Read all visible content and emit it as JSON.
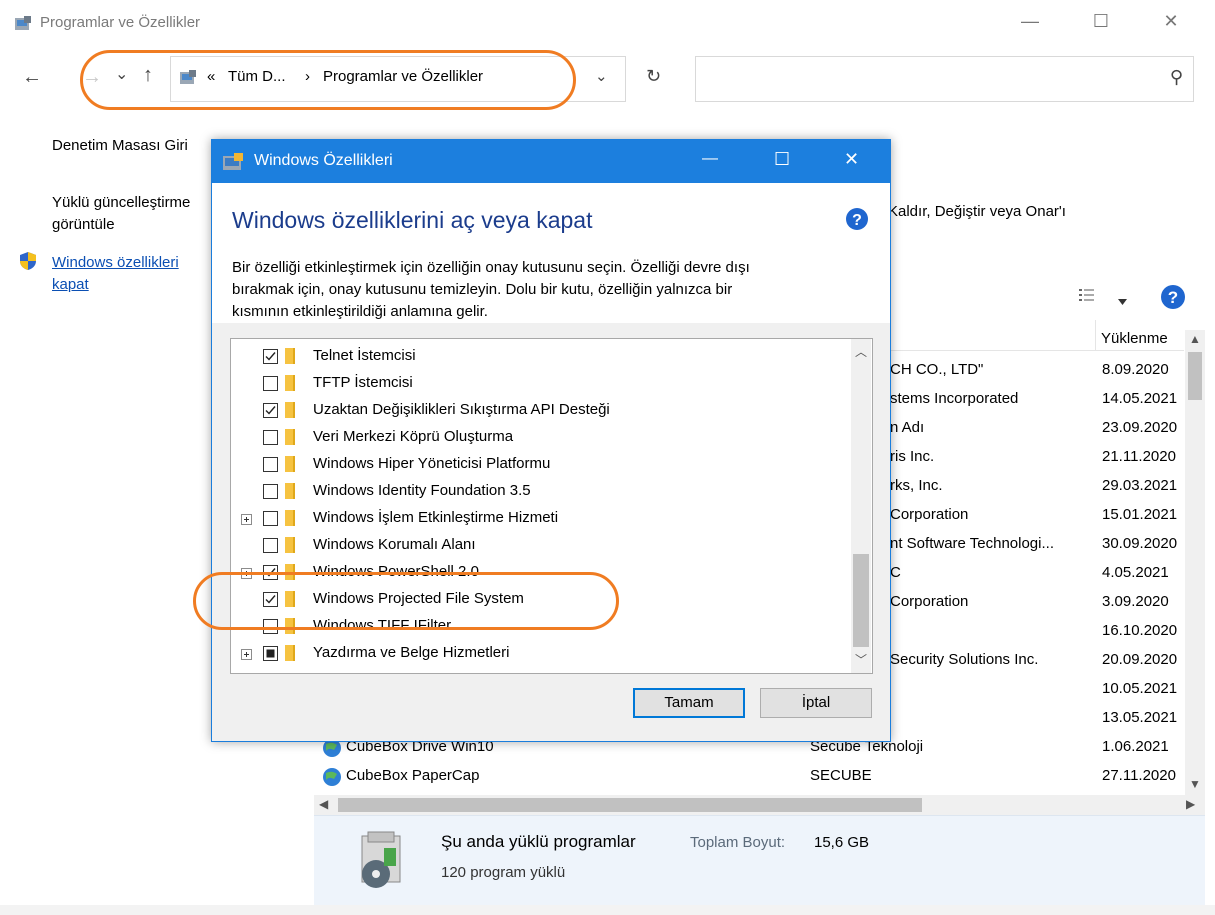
{
  "window": {
    "title": "Programlar ve Özellikler",
    "minimize_glyph": "—",
    "maximize_glyph": "☐",
    "close_glyph": "✕"
  },
  "nav": {
    "back_glyph": "←",
    "forward_glyph": "→",
    "recent_glyph": "⌄",
    "up_glyph": "↑",
    "breadcrumb_prefix": "«",
    "breadcrumb_root": "Tüm D...",
    "breadcrumb_sep": "›",
    "breadcrumb_current": "Programlar ve Özellikler",
    "dropdown_glyph": "⌄",
    "refresh_glyph": "↻",
    "search_glyph": "⚲"
  },
  "sidebar": {
    "home": "Denetim Masası Giri",
    "updates_line1": "Yüklü güncelleştirme",
    "updates_line2": "görüntüle",
    "features_line1": "Windows özellikleri",
    "features_line2": "kapat"
  },
  "main": {
    "intro_tail": "Kaldır, Değiştir veya Onar'ı",
    "col_installed": "Yüklenme",
    "rows": [
      {
        "name": "",
        "publisher": "CH CO., LTD\"",
        "date": "8.09.2020"
      },
      {
        "name": "",
        "publisher": "stems Incorporated",
        "date": "14.05.2021"
      },
      {
        "name": "",
        "publisher": "n Adı",
        "date": "23.09.2020"
      },
      {
        "name": "",
        "publisher": "ris Inc.",
        "date": "21.11.2020"
      },
      {
        "name": "",
        "publisher": "rks, Inc.",
        "date": "29.03.2021"
      },
      {
        "name": "",
        "publisher": "Corporation",
        "date": "15.01.2021"
      },
      {
        "name": "",
        "publisher": "nt Software Technologi...",
        "date": "30.09.2020"
      },
      {
        "name": "",
        "publisher": "C",
        "date": "4.05.2021"
      },
      {
        "name": "",
        "publisher": "Corporation",
        "date": "3.09.2020"
      },
      {
        "name": "",
        "publisher": "",
        "date": "16.10.2020"
      },
      {
        "name": "",
        "publisher": "Security Solutions Inc.",
        "date": "20.09.2020"
      },
      {
        "name": "",
        "publisher": "",
        "date": "10.05.2021"
      },
      {
        "name": "",
        "publisher": "",
        "date": "13.05.2021"
      },
      {
        "name": "CubeBox Drive Win10",
        "publisher": "Secube Teknoloji",
        "date": "1.06.2021"
      },
      {
        "name": "CubeBox PaperCap",
        "publisher": "SECUBE",
        "date": "27.11.2020"
      }
    ],
    "status_title": "Şu anda yüklü programlar",
    "status_size_label": "Toplam Boyut:",
    "status_size_value": "15,6 GB",
    "status_count": "120 program yüklü"
  },
  "dialog": {
    "title": "Windows Özellikleri",
    "heading": "Windows özelliklerini aç veya kapat",
    "description_line1": "Bir özelliği etkinleştirmek için özelliğin onay kutusunu seçin. Özelliği devre dışı",
    "description_line2": "bırakmak için, onay kutusunu temizleyin. Dolu bir kutu, özelliğin yalnızca bir",
    "description_line3": "kısmının etkinleştirildiği anlamına gelir.",
    "features": [
      {
        "label": "Telnet İstemcisi",
        "state": "checked",
        "expandable": false
      },
      {
        "label": "TFTP İstemcisi",
        "state": "unchecked",
        "expandable": false
      },
      {
        "label": "Uzaktan Değişiklikleri Sıkıştırma API Desteği",
        "state": "checked",
        "expandable": false
      },
      {
        "label": "Veri Merkezi Köprü Oluşturma",
        "state": "unchecked",
        "expandable": false
      },
      {
        "label": "Windows Hiper Yöneticisi Platformu",
        "state": "unchecked",
        "expandable": false
      },
      {
        "label": "Windows Identity Foundation 3.5",
        "state": "unchecked",
        "expandable": false
      },
      {
        "label": "Windows İşlem Etkinleştirme Hizmeti",
        "state": "unchecked",
        "expandable": true
      },
      {
        "label": "Windows Korumalı Alanı",
        "state": "unchecked",
        "expandable": false
      },
      {
        "label": "Windows PowerShell 2.0",
        "state": "checked",
        "expandable": true
      },
      {
        "label": "Windows Projected File System",
        "state": "checked",
        "expandable": false
      },
      {
        "label": "Windows TIFF IFilter",
        "state": "unchecked",
        "expandable": false
      },
      {
        "label": "Yazdırma ve Belge Hizmetleri",
        "state": "partial",
        "expandable": true
      }
    ],
    "ok_label": "Tamam",
    "cancel_label": "İptal"
  },
  "colors": {
    "accent": "#1c7fde",
    "link": "#0b4fb3",
    "highlight_ring": "#f07c22",
    "folder": "#f6c341"
  }
}
